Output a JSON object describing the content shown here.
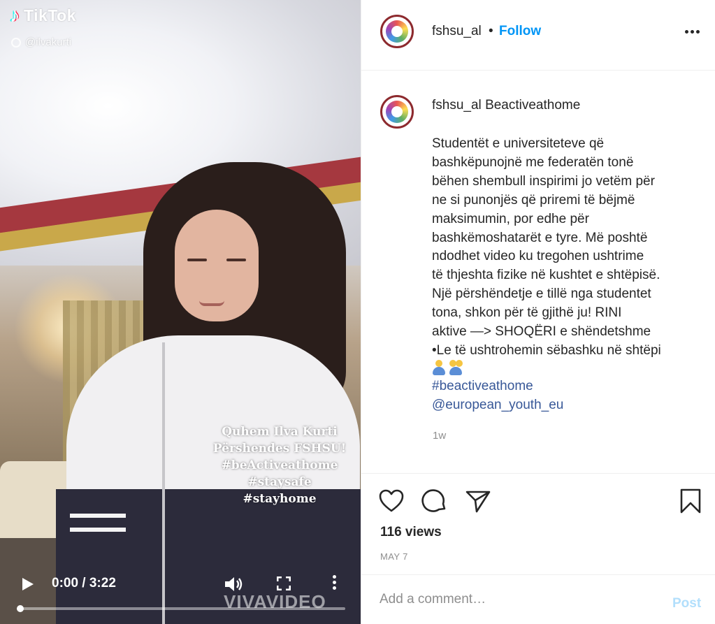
{
  "video": {
    "brand": "TikTok",
    "handle": "@ilvakurti",
    "overlay_lines": [
      "Quhem  Ilva Kurti",
      "Përshendes FSHSU!",
      "#beActiveathome",
      "#staysafe",
      "#stayhome"
    ],
    "watermark": "VIVAVIDEO",
    "time": "0:00 / 3:22",
    "progress": 0
  },
  "header": {
    "username": "fshsu_al",
    "separator": "•",
    "follow_label": "Follow"
  },
  "post": {
    "caption_user": "fshsu_al",
    "caption_title": "Beactiveathome",
    "caption_body": "Studentët e universiteteve që\nbashkëpunojnë me federatën tonë\nbëhen shembull inspirimi jo vetëm për\nne si punonjës që priremi të bëjmë\nmaksimumin, por edhe për\nbashkëmoshatarët e tyre. Më poshtë\nndodhet video ku tregohen ushtrime\ntë thjeshta fizike në kushtet e shtëpisë.\nNjë përshëndetje e tillë nga studentet\ntona, shkon për të gjithë ju! RINI\naktive —> SHOQËRI e shëndetshme\n•Le të ushtrohemin sëbashku në shtëpi",
    "hashtag": "#beactiveathome",
    "mention": "@european_youth_eu",
    "time_ago": "1w",
    "emoji_icons": [
      "person-in-lotus-position-icon",
      "people-wrestling-icon"
    ]
  },
  "actions": {
    "views": "116 views",
    "date": "MAY 7"
  },
  "comment": {
    "placeholder": "Add a comment…",
    "post_label": "Post"
  },
  "colors": {
    "link": "#0095f6",
    "hashtag": "#385898",
    "muted": "#8e8e8e",
    "post_disabled": "#b2dffc"
  }
}
